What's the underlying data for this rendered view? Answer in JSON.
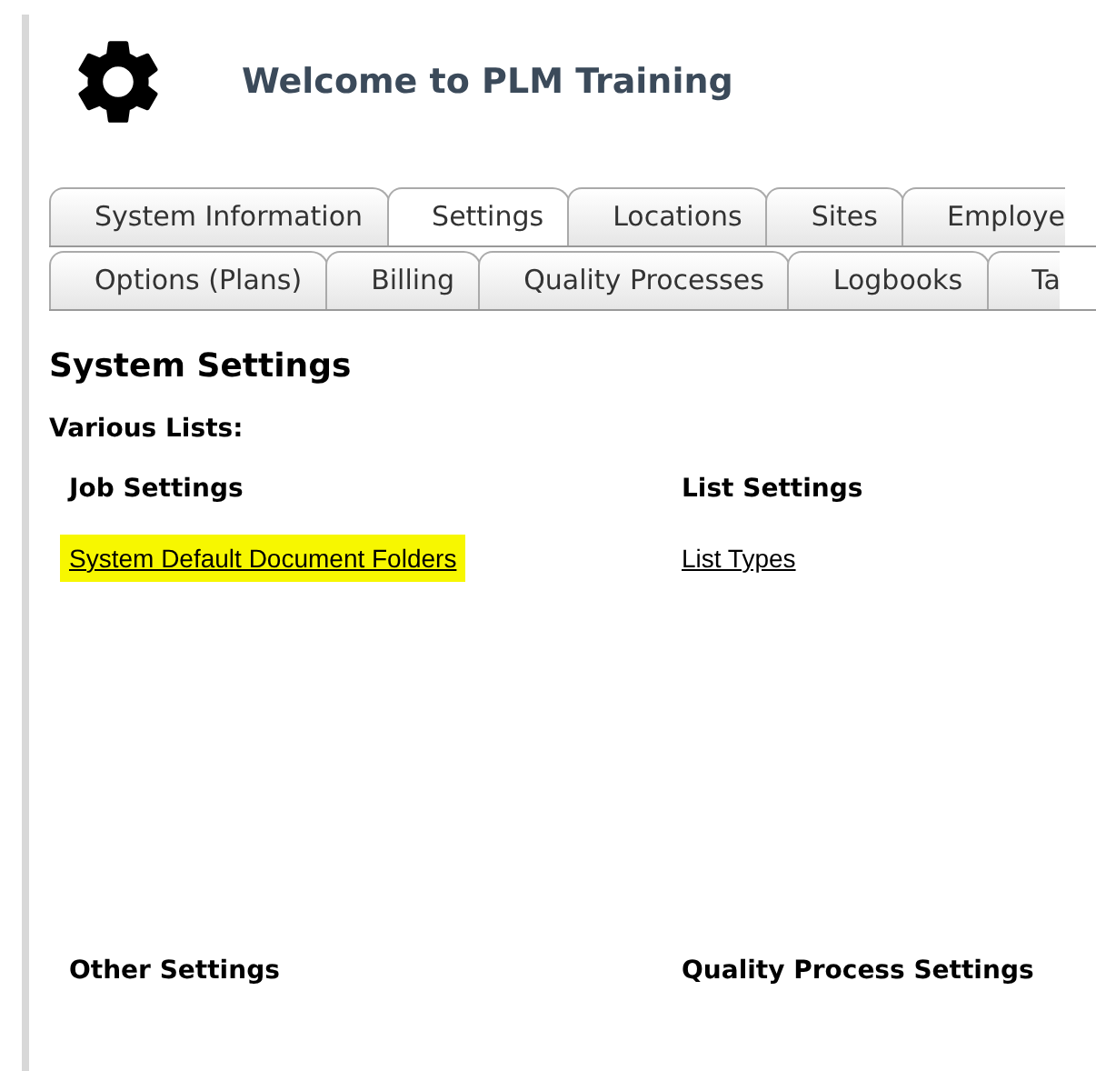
{
  "header": {
    "title": "Welcome to PLM Training"
  },
  "tab_rows": [
    [
      {
        "label": "System Information",
        "selected": false
      },
      {
        "label": "Settings",
        "selected": true
      },
      {
        "label": "Locations",
        "selected": false
      },
      {
        "label": "Sites",
        "selected": false
      },
      {
        "label": "Employe",
        "selected": false
      }
    ],
    [
      {
        "label": "Options (Plans)",
        "selected": false
      },
      {
        "label": "Billing",
        "selected": false
      },
      {
        "label": "Quality Processes",
        "selected": false
      },
      {
        "label": "Logbooks",
        "selected": false
      },
      {
        "label": "Ta",
        "selected": false
      }
    ]
  ],
  "page_title": "System Settings",
  "subtitle": "Various Lists:",
  "sections": [
    {
      "heading": "Job Settings",
      "links": [
        {
          "label": "System Default Document Folders",
          "highlighted": true
        }
      ]
    },
    {
      "heading": "List Settings",
      "links": [
        {
          "label": "List Types",
          "highlighted": false
        }
      ]
    },
    {
      "heading": "Other Settings"
    },
    {
      "heading": "Quality Process Settings"
    }
  ]
}
